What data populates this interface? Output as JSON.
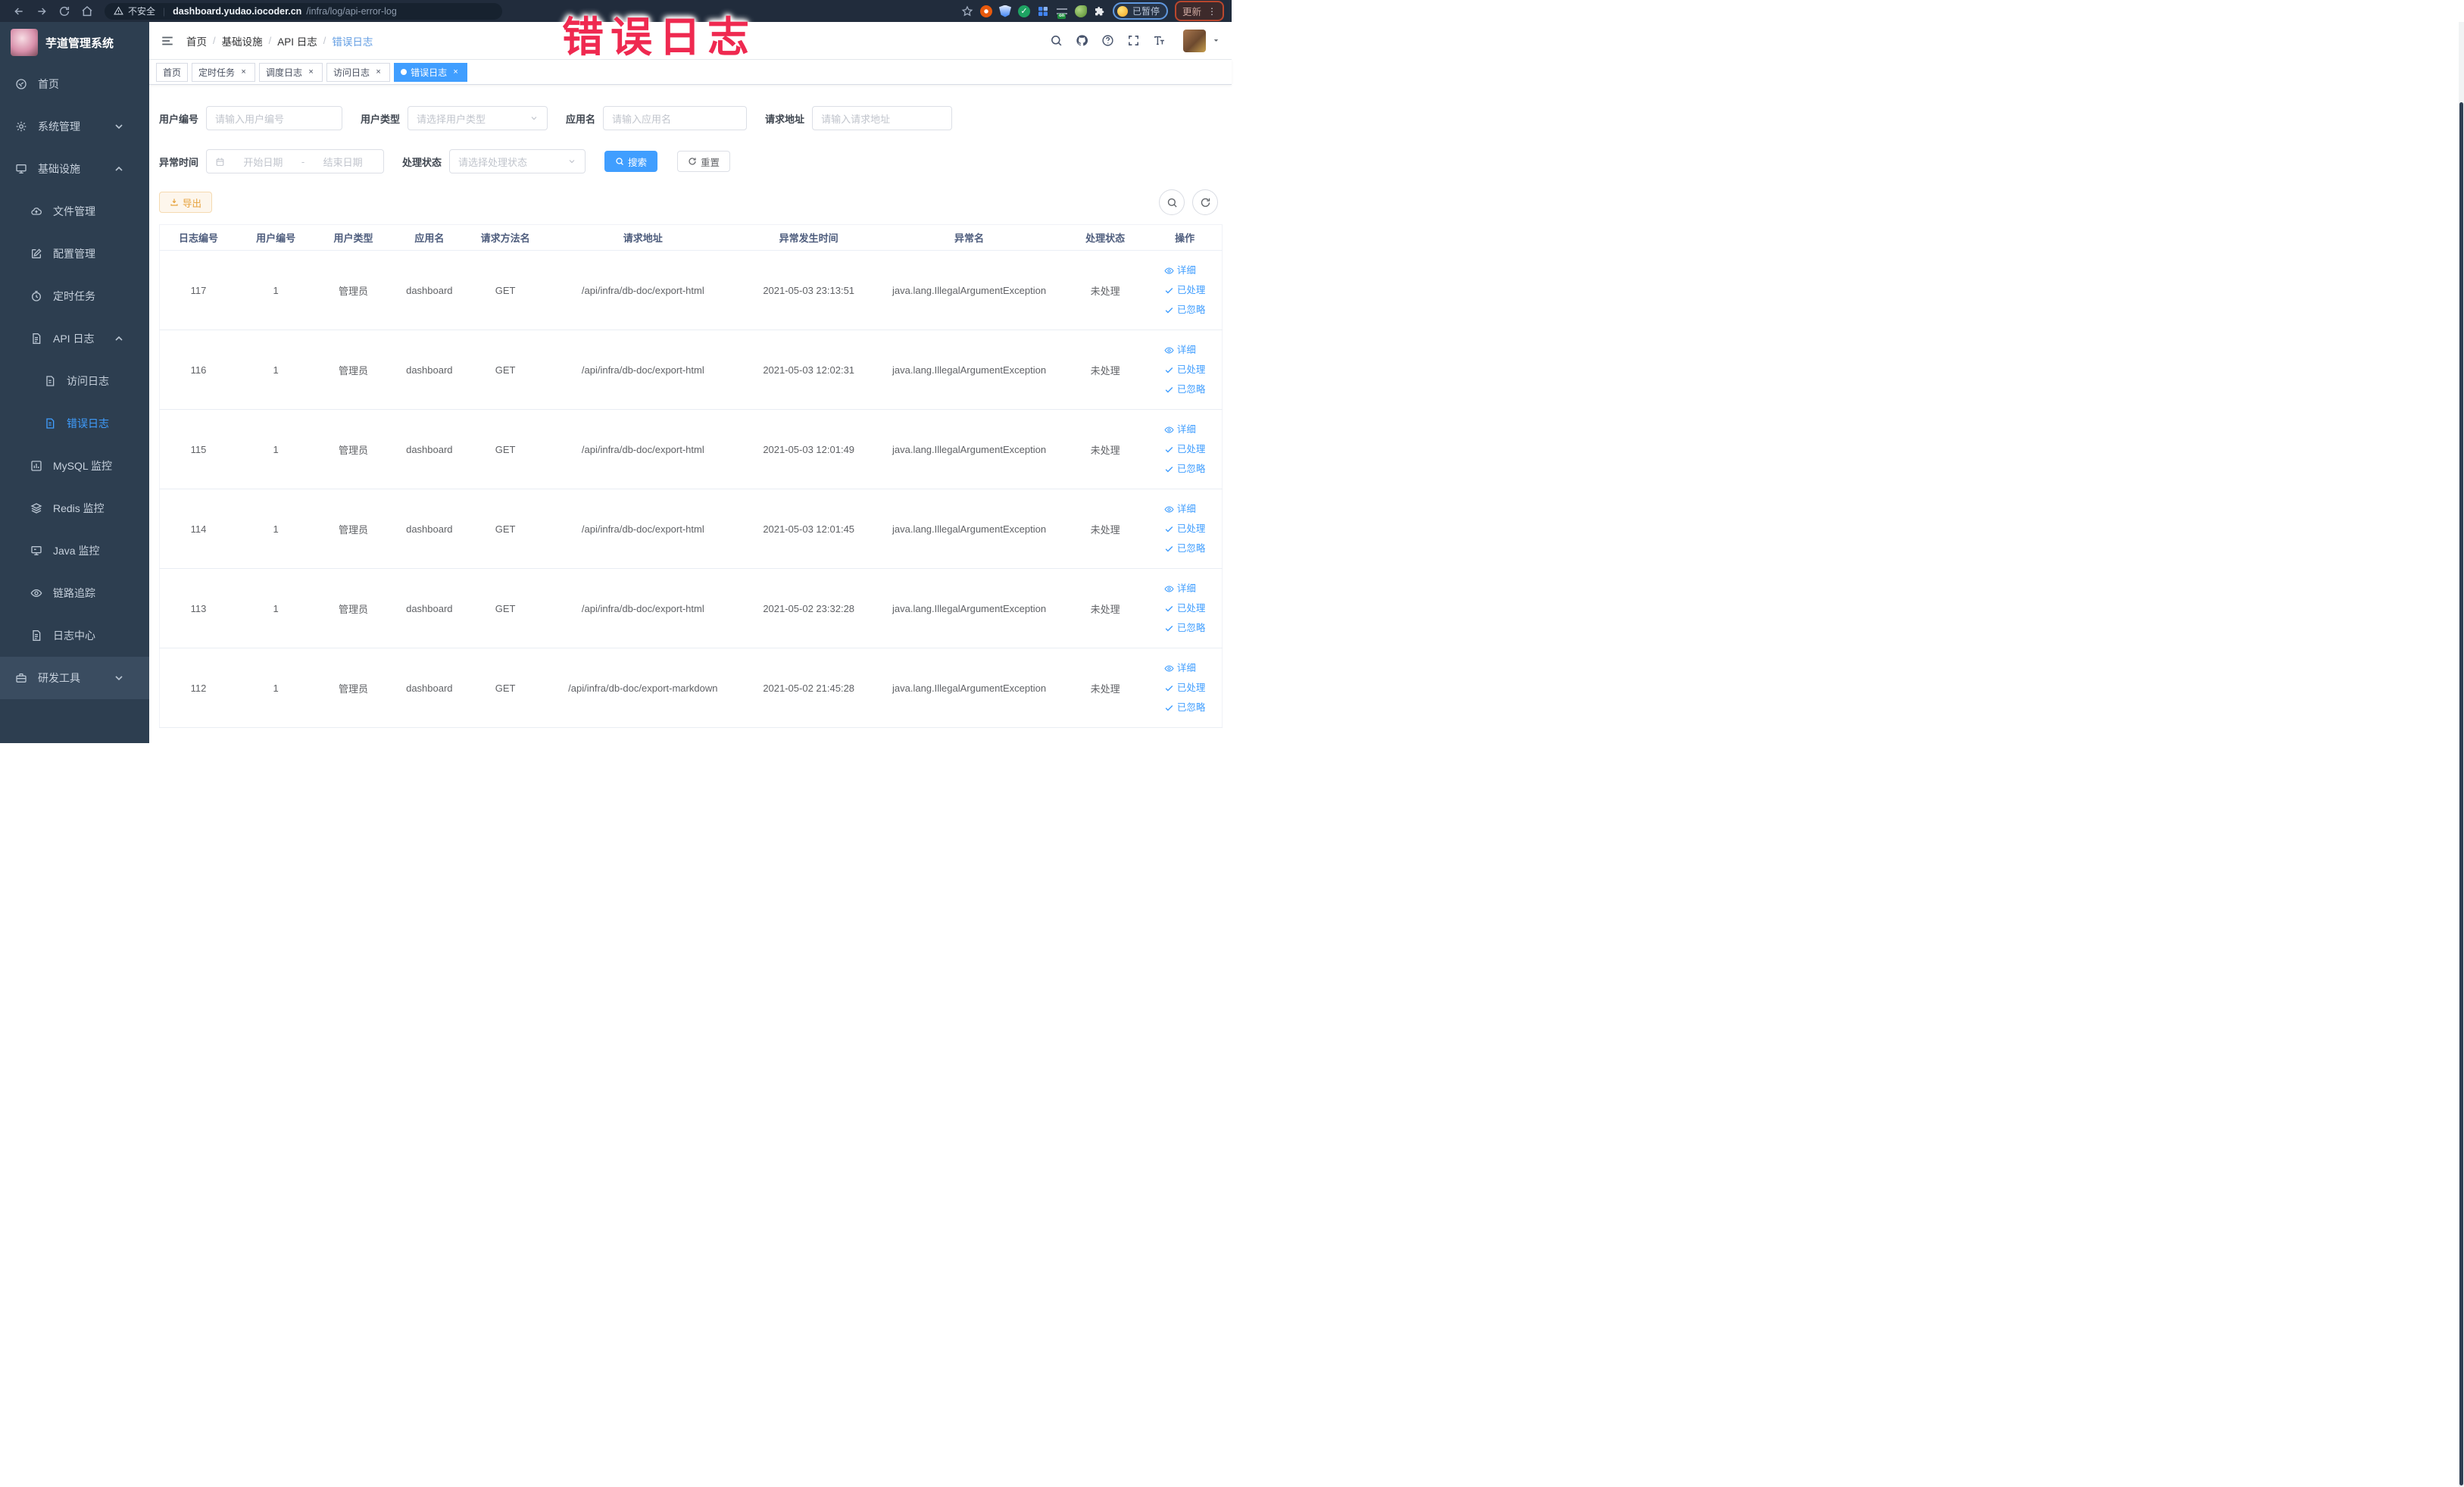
{
  "browser": {
    "security_label": "不安全",
    "url_host": "dashboard.yudao.iocoder.cn",
    "url_path": "/infra/log/api-error-log",
    "paused_badge": "已暂停",
    "update_label": "更新"
  },
  "overlay": {
    "text": "错误日志",
    "color": "#ef2950"
  },
  "sidebar": {
    "app_name": "芋道管理系统",
    "items": [
      {
        "label": "首页",
        "icon": "dashboard",
        "level": 1
      },
      {
        "label": "系统管理",
        "icon": "gear",
        "level": 1,
        "chevron": "down"
      },
      {
        "label": "基础设施",
        "icon": "infra",
        "level": 1,
        "chevron": "up"
      },
      {
        "label": "文件管理",
        "icon": "cloud",
        "level": 2
      },
      {
        "label": "配置管理",
        "icon": "edit",
        "level": 2
      },
      {
        "label": "定时任务",
        "icon": "timer",
        "level": 2
      },
      {
        "label": "API 日志",
        "icon": "log",
        "level": 2,
        "chevron": "up"
      },
      {
        "label": "访问日志",
        "icon": "doc",
        "level": 3
      },
      {
        "label": "错误日志",
        "icon": "doc",
        "level": 3,
        "active": true
      },
      {
        "label": "MySQL 监控",
        "icon": "chart",
        "level": 2
      },
      {
        "label": "Redis 监控",
        "icon": "layers",
        "level": 2
      },
      {
        "label": "Java 监控",
        "icon": "monitor",
        "level": 2
      },
      {
        "label": "链路追踪",
        "icon": "eye",
        "level": 2
      },
      {
        "label": "日志中心",
        "icon": "log",
        "level": 2
      },
      {
        "label": "研发工具",
        "icon": "tool",
        "level": 1,
        "chevron": "down",
        "highlight": true
      }
    ]
  },
  "header": {
    "breadcrumb": [
      "首页",
      "基础设施",
      "API 日志",
      "错误日志"
    ]
  },
  "tabs": [
    {
      "label": "首页",
      "closable": false,
      "active": false
    },
    {
      "label": "定时任务",
      "closable": true,
      "active": false
    },
    {
      "label": "调度日志",
      "closable": true,
      "active": false
    },
    {
      "label": "访问日志",
      "closable": true,
      "active": false
    },
    {
      "label": "错误日志",
      "closable": true,
      "active": true
    }
  ],
  "filters": {
    "user_id_label": "用户编号",
    "user_id_placeholder": "请输入用户编号",
    "user_type_label": "用户类型",
    "user_type_placeholder": "请选择用户类型",
    "app_name_label": "应用名",
    "app_name_placeholder": "请输入应用名",
    "request_url_label": "请求地址",
    "request_url_placeholder": "请输入请求地址",
    "exception_time_label": "异常时间",
    "start_date_placeholder": "开始日期",
    "date_separator": "-",
    "end_date_placeholder": "结束日期",
    "process_status_label": "处理状态",
    "process_status_placeholder": "请选择处理状态",
    "search_label": "搜索",
    "reset_label": "重置"
  },
  "toolbar": {
    "export_label": "导出"
  },
  "table": {
    "columns": [
      "日志编号",
      "用户编号",
      "用户类型",
      "应用名",
      "请求方法名",
      "请求地址",
      "异常发生时间",
      "异常名",
      "处理状态",
      "操作"
    ],
    "actions": [
      "详细",
      "已处理",
      "已忽略"
    ],
    "rows": [
      {
        "id": "117",
        "user_id": "1",
        "user_type": "管理员",
        "app_name": "dashboard",
        "method": "GET",
        "url": "/api/infra/db-doc/export-html",
        "time": "2021-05-03 23:13:51",
        "exception": "java.lang.IllegalArgumentException",
        "status": "未处理"
      },
      {
        "id": "116",
        "user_id": "1",
        "user_type": "管理员",
        "app_name": "dashboard",
        "method": "GET",
        "url": "/api/infra/db-doc/export-html",
        "time": "2021-05-03 12:02:31",
        "exception": "java.lang.IllegalArgumentException",
        "status": "未处理"
      },
      {
        "id": "115",
        "user_id": "1",
        "user_type": "管理员",
        "app_name": "dashboard",
        "method": "GET",
        "url": "/api/infra/db-doc/export-html",
        "time": "2021-05-03 12:01:49",
        "exception": "java.lang.IllegalArgumentException",
        "status": "未处理"
      },
      {
        "id": "114",
        "user_id": "1",
        "user_type": "管理员",
        "app_name": "dashboard",
        "method": "GET",
        "url": "/api/infra/db-doc/export-html",
        "time": "2021-05-03 12:01:45",
        "exception": "java.lang.IllegalArgumentException",
        "status": "未处理"
      },
      {
        "id": "113",
        "user_id": "1",
        "user_type": "管理员",
        "app_name": "dashboard",
        "method": "GET",
        "url": "/api/infra/db-doc/export-html",
        "time": "2021-05-02 23:32:28",
        "exception": "java.lang.IllegalArgumentException",
        "status": "未处理"
      },
      {
        "id": "112",
        "user_id": "1",
        "user_type": "管理员",
        "app_name": "dashboard",
        "method": "GET",
        "url": "/api/infra/db-doc/export-markdown",
        "time": "2021-05-02 21:45:28",
        "exception": "java.lang.IllegalArgumentException",
        "status": "未处理"
      }
    ]
  },
  "colors": {
    "accent": "#409eff",
    "warning": "#e6a23c",
    "overlay_red": "#ef2950",
    "sidebar_bg": "#2d3e50",
    "browser_bar_bg": "#212c3c"
  }
}
